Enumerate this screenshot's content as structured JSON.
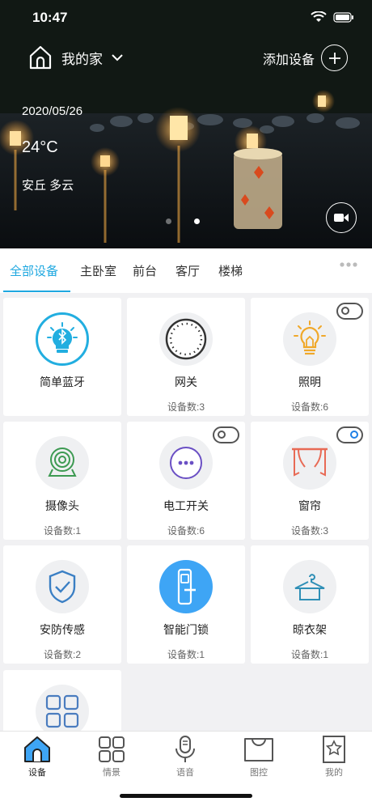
{
  "status": {
    "time": "10:47"
  },
  "header": {
    "home_name": "我的家",
    "add_label": "添加设备"
  },
  "weather": {
    "date": "2020/05/26",
    "temp": "24°C",
    "location": "安丘 多云"
  },
  "tabs": [
    {
      "label": "全部设备",
      "active": true
    },
    {
      "label": "主卧室"
    },
    {
      "label": "前台"
    },
    {
      "label": "客厅"
    },
    {
      "label": "楼梯"
    }
  ],
  "devices": [
    {
      "name": "简单蓝牙",
      "count": "",
      "icon": "bluetooth-bulb-icon"
    },
    {
      "name": "网关",
      "count": "设备数:3",
      "icon": "gateway-icon"
    },
    {
      "name": "照明",
      "count": "设备数:6",
      "icon": "light-bulb-icon",
      "toggle": "off"
    },
    {
      "name": "摄像头",
      "count": "设备数:1",
      "icon": "camera-icon"
    },
    {
      "name": "电工开关",
      "count": "设备数:6",
      "icon": "switch-icon",
      "toggle": "off"
    },
    {
      "name": "窗帘",
      "count": "设备数:3",
      "icon": "curtain-icon",
      "toggle": "on"
    },
    {
      "name": "安防传感",
      "count": "设备数:2",
      "icon": "shield-icon"
    },
    {
      "name": "智能门锁",
      "count": "设备数:1",
      "icon": "door-lock-icon"
    },
    {
      "name": "晾衣架",
      "count": "设备数:1",
      "icon": "hanger-icon"
    },
    {
      "name": "",
      "count": "",
      "icon": "grid-icon"
    }
  ],
  "nav": [
    {
      "label": "设备",
      "icon": "home-icon",
      "active": true
    },
    {
      "label": "情景",
      "icon": "scenes-icon"
    },
    {
      "label": "语音",
      "icon": "mic-icon"
    },
    {
      "label": "图控",
      "icon": "bag-icon"
    },
    {
      "label": "我的",
      "icon": "profile-icon"
    }
  ],
  "colors": {
    "accent": "#1fa8e0",
    "lock_blue": "#3ea5f5"
  }
}
